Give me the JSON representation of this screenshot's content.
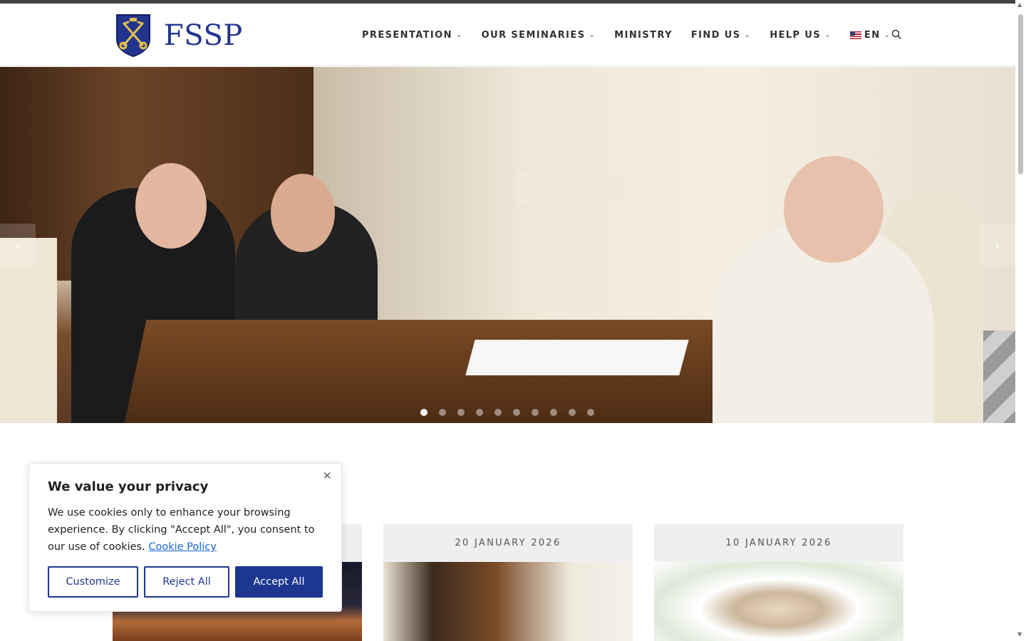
{
  "brand": {
    "name": "FSSP",
    "color": "#23348f"
  },
  "nav": {
    "items": [
      {
        "label": "PRESENTATION",
        "dropdown": true
      },
      {
        "label": "OUR SEMINARIES",
        "dropdown": true
      },
      {
        "label": "MINISTRY",
        "dropdown": false
      },
      {
        "label": "FIND US",
        "dropdown": true
      },
      {
        "label": "HELP US",
        "dropdown": true
      }
    ],
    "language": "EN",
    "search_icon": "search-icon"
  },
  "slider": {
    "slide_count": 10,
    "active_slide": 1,
    "prev_icon": "chevron-left-icon",
    "next_icon": "chevron-right-icon"
  },
  "posts": [
    {
      "date": ""
    },
    {
      "date": "20 JANUARY 2026"
    },
    {
      "date": "10 JANUARY 2026"
    }
  ],
  "cookie": {
    "title": "We value your privacy",
    "text": "We use cookies only to enhance your browsing experience. By clicking \"Accept All\", you consent to our use of cookies.",
    "link": "Cookie Policy",
    "customize": "Customize",
    "reject": "Reject All",
    "accept": "Accept All",
    "accent": "#1d3791"
  }
}
